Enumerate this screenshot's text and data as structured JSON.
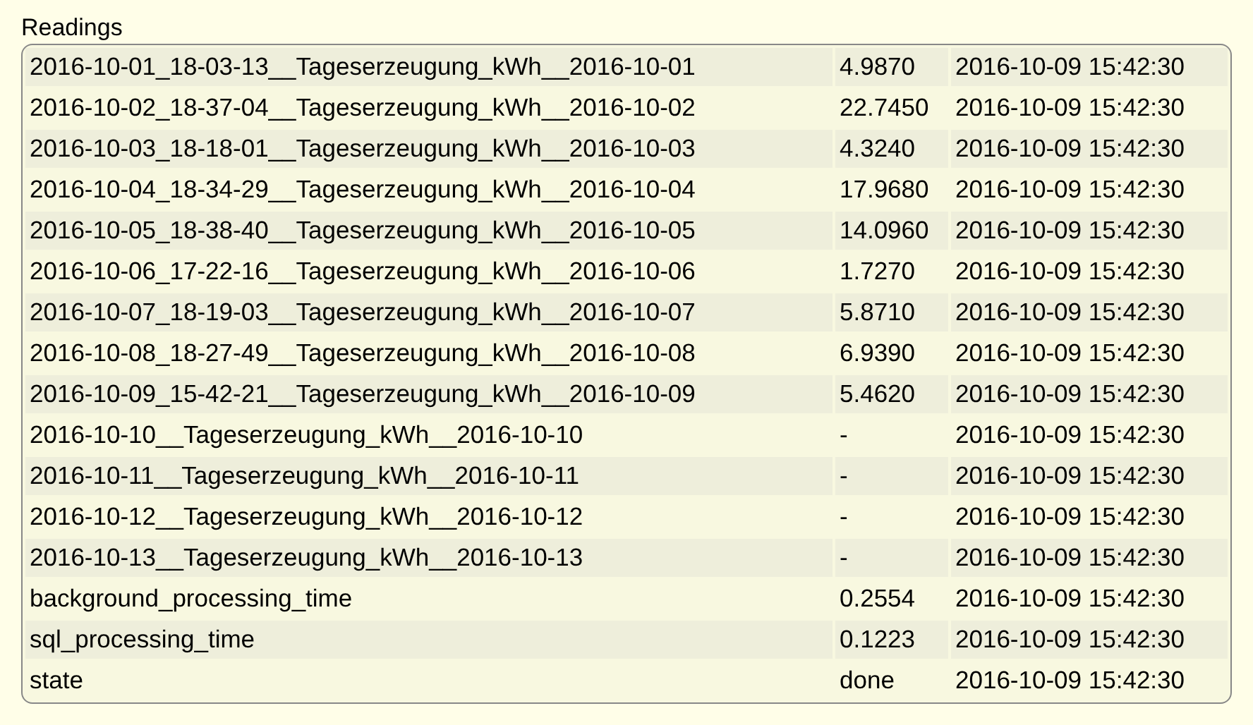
{
  "title": "Readings",
  "rows": [
    {
      "name": "2016-10-01_18-03-13__Tageserzeugung_kWh__2016-10-01",
      "value": "4.9870",
      "time": "2016-10-09 15:42:30"
    },
    {
      "name": "2016-10-02_18-37-04__Tageserzeugung_kWh__2016-10-02",
      "value": "22.7450",
      "time": "2016-10-09 15:42:30"
    },
    {
      "name": "2016-10-03_18-18-01__Tageserzeugung_kWh__2016-10-03",
      "value": "4.3240",
      "time": "2016-10-09 15:42:30"
    },
    {
      "name": "2016-10-04_18-34-29__Tageserzeugung_kWh__2016-10-04",
      "value": "17.9680",
      "time": "2016-10-09 15:42:30"
    },
    {
      "name": "2016-10-05_18-38-40__Tageserzeugung_kWh__2016-10-05",
      "value": "14.0960",
      "time": "2016-10-09 15:42:30"
    },
    {
      "name": "2016-10-06_17-22-16__Tageserzeugung_kWh__2016-10-06",
      "value": "1.7270",
      "time": "2016-10-09 15:42:30"
    },
    {
      "name": "2016-10-07_18-19-03__Tageserzeugung_kWh__2016-10-07",
      "value": "5.8710",
      "time": "2016-10-09 15:42:30"
    },
    {
      "name": "2016-10-08_18-27-49__Tageserzeugung_kWh__2016-10-08",
      "value": "6.9390",
      "time": "2016-10-09 15:42:30"
    },
    {
      "name": "2016-10-09_15-42-21__Tageserzeugung_kWh__2016-10-09",
      "value": "5.4620",
      "time": "2016-10-09 15:42:30"
    },
    {
      "name": "2016-10-10__Tageserzeugung_kWh__2016-10-10",
      "value": "-",
      "time": "2016-10-09 15:42:30"
    },
    {
      "name": "2016-10-11__Tageserzeugung_kWh__2016-10-11",
      "value": "-",
      "time": "2016-10-09 15:42:30"
    },
    {
      "name": "2016-10-12__Tageserzeugung_kWh__2016-10-12",
      "value": "-",
      "time": "2016-10-09 15:42:30"
    },
    {
      "name": "2016-10-13__Tageserzeugung_kWh__2016-10-13",
      "value": "-",
      "time": "2016-10-09 15:42:30"
    },
    {
      "name": "background_processing_time",
      "value": "0.2554",
      "time": "2016-10-09 15:42:30"
    },
    {
      "name": "sql_processing_time",
      "value": "0.1223",
      "time": "2016-10-09 15:42:30"
    },
    {
      "name": "state",
      "value": "done",
      "time": "2016-10-09 15:42:30"
    }
  ]
}
